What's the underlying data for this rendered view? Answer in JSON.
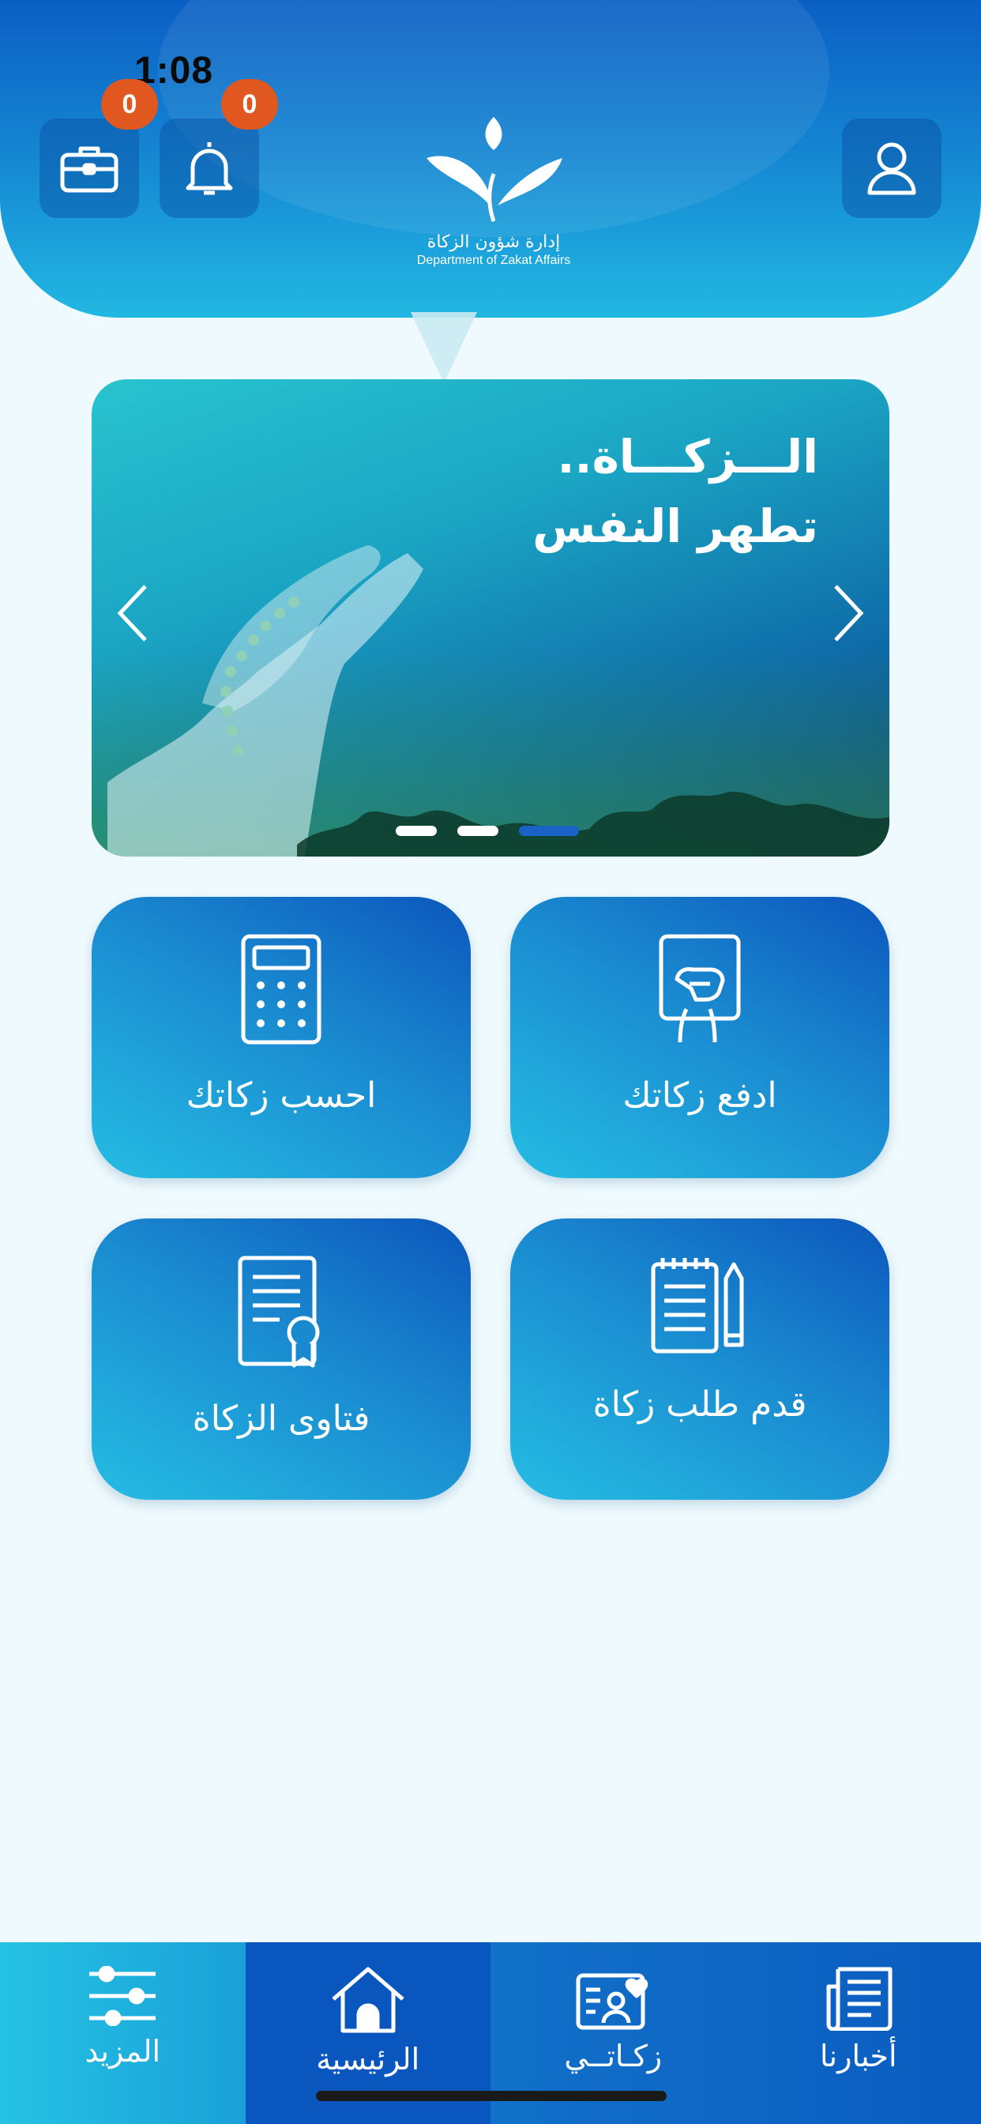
{
  "status_bar": {
    "time": "1:08"
  },
  "header": {
    "briefcase_badge": "0",
    "bell_badge": "0",
    "logo_text_ar": "إدارة شؤون الزكاة",
    "logo_text_en": "Department of Zakat Affairs"
  },
  "banner": {
    "title_line1": "الـــزكـــاة..",
    "title_line2": "تطهر النفس",
    "slides_total": 3,
    "active_slide": 3
  },
  "cards": {
    "pay": "ادفع زكاتك",
    "calc": "احسب زكاتك",
    "request": "قدم طلب زكاة",
    "fatwa": "فتاوى الزكاة"
  },
  "nav": {
    "more": "المزيد",
    "home": "الرئيسية",
    "my_zakat": "زكـاتــي",
    "news": "أخبارنا"
  },
  "colors": {
    "primary": "#0c57bc",
    "accent": "#25bde3",
    "badge": "#e0571f",
    "background": "#eefafd"
  }
}
